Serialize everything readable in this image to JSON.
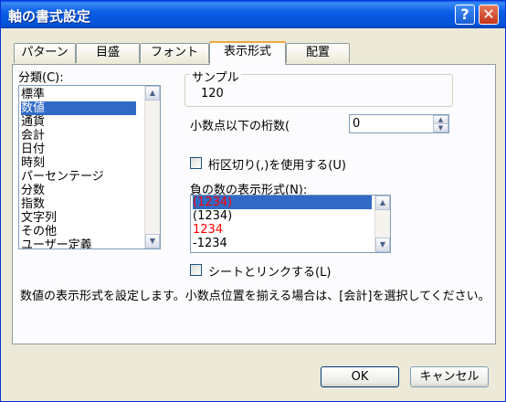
{
  "window": {
    "title": "軸の書式設定"
  },
  "tabs": [
    {
      "label": "パターン"
    },
    {
      "label": "目盛"
    },
    {
      "label": "フォント"
    },
    {
      "label": "表示形式"
    },
    {
      "label": "配置"
    }
  ],
  "category": {
    "label": "分類(C):",
    "items": [
      "標準",
      "数値",
      "通貨",
      "会計",
      "日付",
      "時刻",
      "パーセンテージ",
      "分数",
      "指数",
      "文字列",
      "その他",
      "ユーザー定義"
    ],
    "selected": "数値"
  },
  "sample": {
    "label": "サンプル",
    "value": "120"
  },
  "decimal": {
    "label": "小数点以下の桁数(",
    "value": "0"
  },
  "separator": {
    "label": "桁区切り(,)を使用する(U)",
    "checked": false
  },
  "negative": {
    "label": "負の数の表示形式(N):",
    "items": [
      {
        "text": "(1234)",
        "color": "#ff0000",
        "selected": true
      },
      {
        "text": "(1234)",
        "color": "#000000"
      },
      {
        "text": "1234",
        "color": "#ff0000"
      },
      {
        "text": "-1234",
        "color": "#000000"
      }
    ]
  },
  "link": {
    "label": "シートとリンクする(L)",
    "checked": false
  },
  "description": "数値の表示形式を設定します。小数点位置を揃える場合は、[会計]を選択してください。",
  "buttons": {
    "ok": "OK",
    "cancel": "キャンセル"
  },
  "colors": {
    "titlebar": "#0453d8",
    "selection": "#316ac5",
    "dialog": "#ece9d8"
  }
}
